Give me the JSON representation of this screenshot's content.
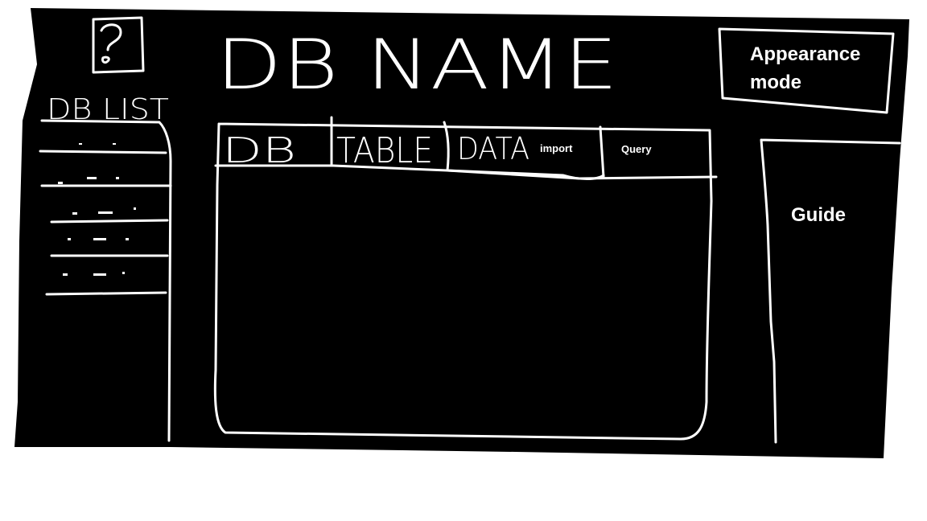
{
  "header": {
    "title": "DB NAME",
    "help_icon": "question-mark-icon",
    "appearance_button": "Appearance mode"
  },
  "sidebar": {
    "title": "DB LIST",
    "items": [
      "",
      "",
      "",
      "",
      ""
    ]
  },
  "tabs": [
    {
      "label": "DB"
    },
    {
      "label": "TABLE"
    },
    {
      "label": "DATA"
    }
  ],
  "data_actions": {
    "import_label": "import",
    "query_label": "Query"
  },
  "guide": {
    "label": "Guide"
  },
  "colors": {
    "background": "#000000",
    "ink": "#ffffff",
    "page": "#ffffff"
  }
}
